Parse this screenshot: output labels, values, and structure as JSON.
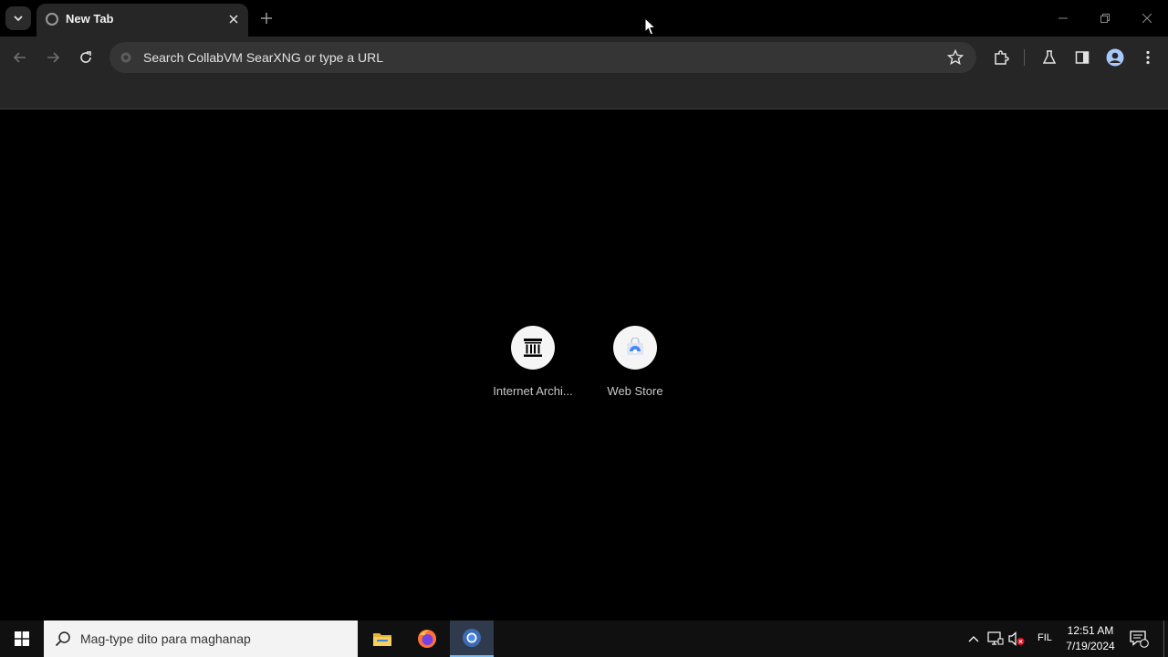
{
  "browser": {
    "tab": {
      "title": "New Tab"
    },
    "omnibox": {
      "placeholder": "Search CollabVM SearXNG or type a URL"
    }
  },
  "new_tab_page": {
    "shortcuts": [
      {
        "label": "Internet Archi...",
        "icon": "internet-archive-icon"
      },
      {
        "label": "Web Store",
        "icon": "web-store-icon"
      }
    ]
  },
  "taskbar": {
    "search_placeholder": "Mag-type dito para maghanap",
    "apps": [
      "file-explorer-icon",
      "firefox-icon",
      "chrome-icon"
    ],
    "active_app": "chrome-icon",
    "language": "FIL",
    "time": "12:51 AM",
    "date": "7/19/2024"
  },
  "colors": {
    "page_background": "#000000",
    "toolbar": "#262626",
    "omnibox": "#353535",
    "taskbar": "#101010",
    "accent": "#76b9ed"
  }
}
